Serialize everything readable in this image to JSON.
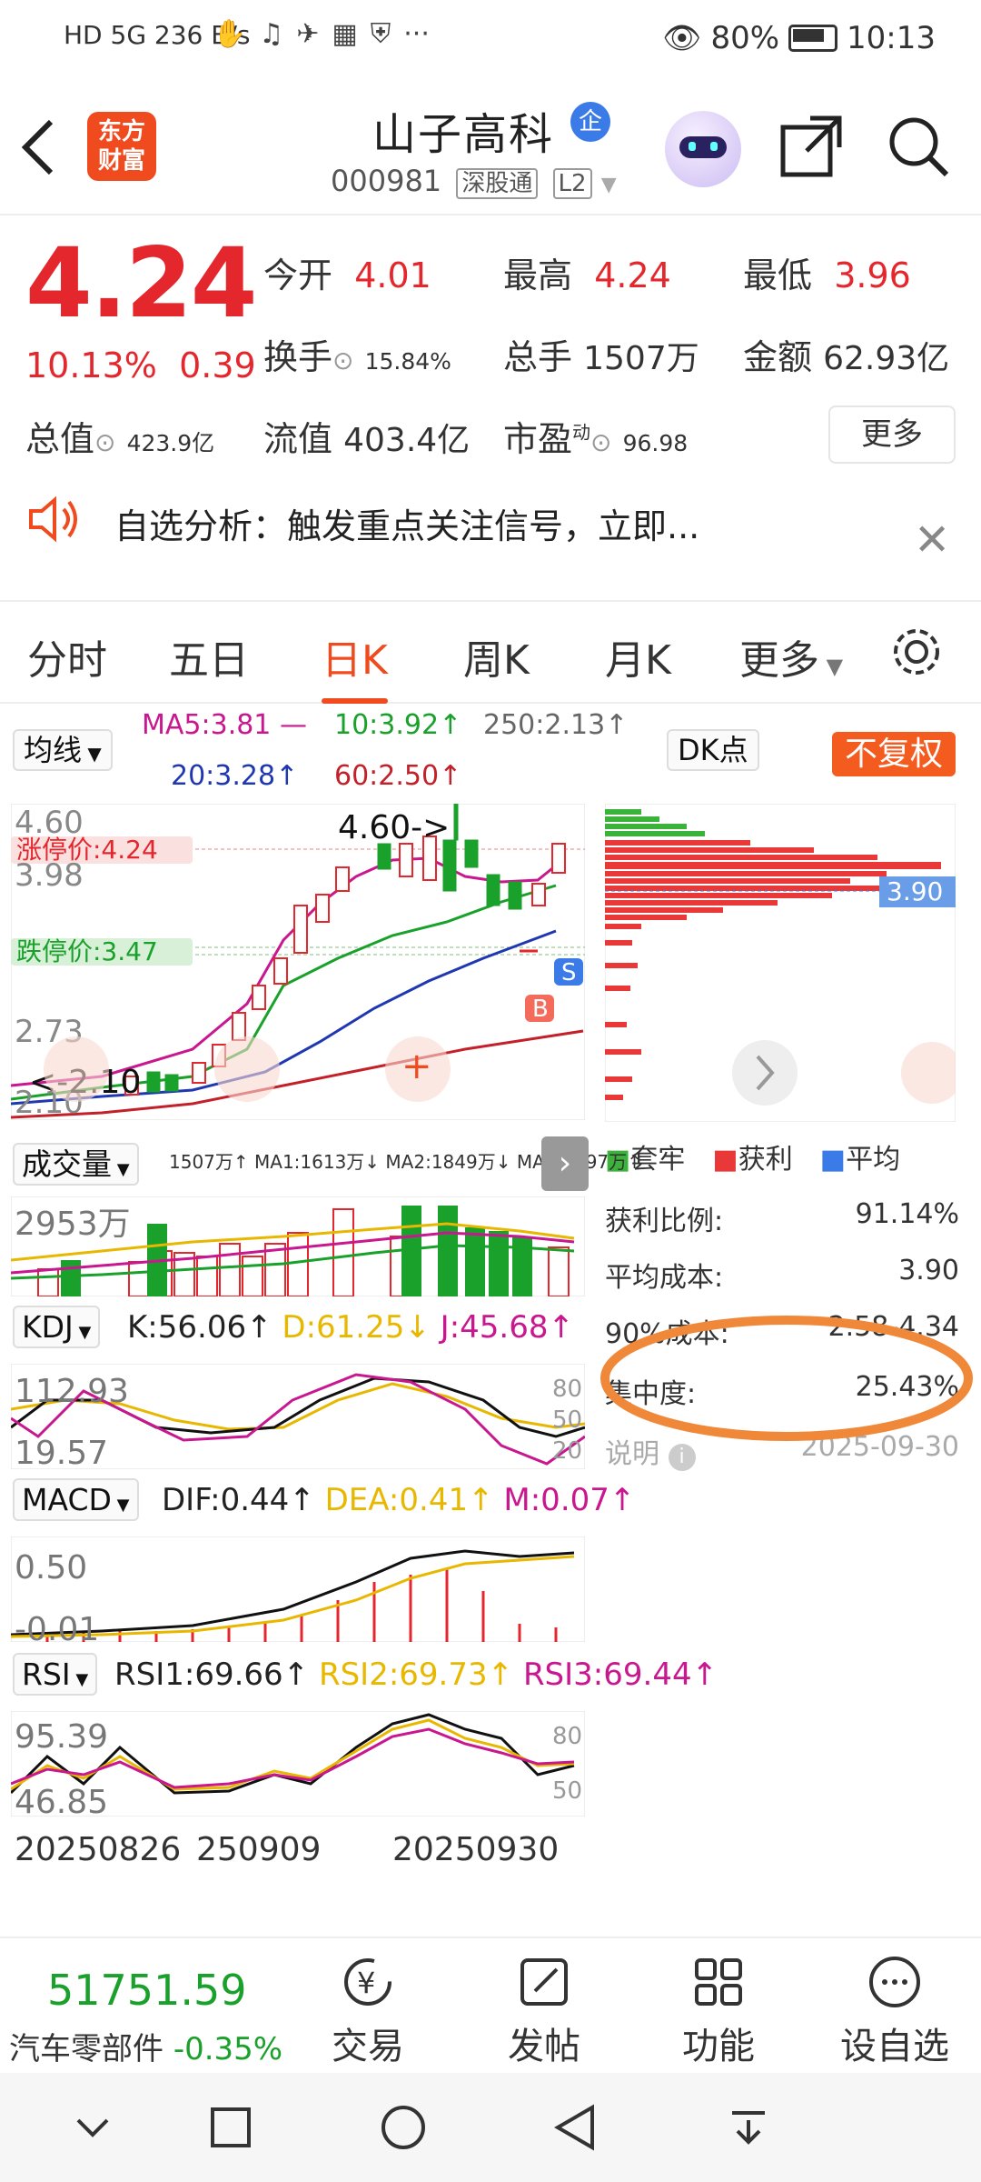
{
  "status": {
    "left": "HD 5G 236 B/s",
    "battery": "80%",
    "time": "10:13"
  },
  "header": {
    "logo_text_1": "东方",
    "logo_text_2": "财富",
    "stock_name": "山子高科",
    "badge": "企",
    "code": "000981",
    "tag1": "深股通",
    "tag2": "L2"
  },
  "quote": {
    "price": "4.24",
    "change_pct": "10.13%",
    "change_amt": "0.39",
    "open_label": "今开",
    "open": "4.01",
    "high_label": "最高",
    "high": "4.24",
    "low_label": "最低",
    "low": "3.96",
    "turnover_label": "换手",
    "turnover": "15.84%",
    "volume_label": "总手",
    "volume": "1507万",
    "amount_label": "金额",
    "amount": "62.93亿",
    "mktcap_label": "总值",
    "mktcap": "423.9亿",
    "float_label": "流值",
    "float": "403.4亿",
    "pe_label": "市盈",
    "pe_sup": "动",
    "pe": "96.98",
    "more": "更多"
  },
  "notice": {
    "text": "自选分析：触发重点关注信号，立即..."
  },
  "tabs": [
    "分时",
    "五日",
    "日K",
    "周K",
    "月K",
    "更多"
  ],
  "active_tab": 2,
  "ma": {
    "label": "均线",
    "ma5": "MA5:3.81",
    "ma10": "10:3.92↑",
    "ma250": "250:2.13↑",
    "ma20": "20:3.28↑",
    "ma60": "60:2.50↑",
    "dk": "DK点",
    "fq": "不复权"
  },
  "kline": {
    "y_top": "4.60",
    "y_mid": "3.98",
    "y_low": "2.73",
    "y_bot": "2.10",
    "annot_high": "4.60->",
    "annot_low": "<-2.10",
    "limit_up": "涨停价:4.24",
    "limit_down": "跌停价:3.47",
    "cost_marker": "3.90",
    "b_mark": "B",
    "s_mark": "S",
    "colors": {
      "up": "#e4262d",
      "down": "#1aa12b",
      "ma5": "#c8178f",
      "ma10": "#1aa12b",
      "ma20": "#1f38b2",
      "ma60": "#c4202a"
    }
  },
  "volume": {
    "label": "成交量",
    "vals": "1507万↑ MA1:1613万↓ MA2:1849万↓ MA3:1697万↑",
    "y": "2953万"
  },
  "kdj": {
    "label": "KDJ",
    "k": "K:56.06↑",
    "d": "D:61.25↓",
    "j": "J:45.68↑",
    "y1": "112.93",
    "y2": "19.57",
    "r80": "80",
    "r50": "50",
    "r20": "20"
  },
  "macd": {
    "label": "MACD",
    "dif": "DIF:0.44↑",
    "dea": "DEA:0.41↑",
    "m": "M:0.07↑",
    "y1": "0.50",
    "y2": "-0.01"
  },
  "rsi": {
    "label": "RSI",
    "r1": "RSI1:69.66↑",
    "r2": "RSI2:69.73↑",
    "r3": "RSI3:69.44↑",
    "y1": "95.39",
    "y2": "46.85",
    "r80": "80",
    "r50": "50"
  },
  "dates": {
    "d1": "20250826",
    "d2": "250909",
    "d3": "20250930"
  },
  "chips": {
    "legend_trap": "套牢",
    "legend_profit": "获利",
    "legend_avg": "平均",
    "profit_ratio_label": "获利比例:",
    "profit_ratio": "91.14%",
    "avg_cost_label": "平均成本:",
    "avg_cost": "3.90",
    "cost90_label": "90%成本:",
    "cost90": "2.58-4.34",
    "concentration_label": "集中度:",
    "concentration": "25.43%",
    "note_label": "说明",
    "note_date": "2025-09-30"
  },
  "bottom": {
    "index_value": "51751.59",
    "index_name": "汽车零部件",
    "index_chg": "-0.35%",
    "trade": "交易",
    "post": "发帖",
    "func": "功能",
    "watch": "设自选"
  }
}
